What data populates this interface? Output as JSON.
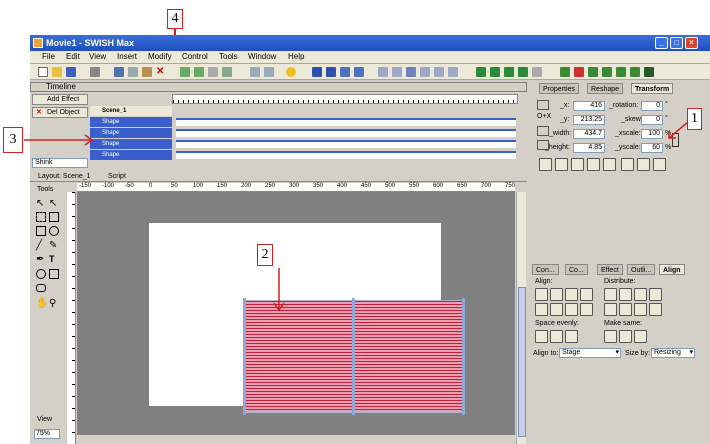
{
  "window": {
    "title": "Movie1 - SWISH Max"
  },
  "menu": [
    "File",
    "Edit",
    "View",
    "Insert",
    "Modify",
    "Control",
    "Tools",
    "Window",
    "Help"
  ],
  "timeline": {
    "header": "Timeline",
    "add_effect": "Add Effect",
    "del_object": "Del Object",
    "scene_label": "Scene_1",
    "rows": [
      "Shape",
      "Shape",
      "Shape",
      "Shape"
    ],
    "effect_field": "Shink"
  },
  "layout": {
    "tab_layout": "Layout: Scene_1",
    "tab_script": "Script",
    "tools_label": "Tools",
    "view_label": "View",
    "zoom": "75%",
    "ruler_ticks": [
      "-150",
      "-100",
      "-50",
      "0",
      "50",
      "100",
      "150",
      "200",
      "250",
      "300",
      "350",
      "400",
      "450",
      "500",
      "550",
      "600",
      "650",
      "700",
      "750"
    ]
  },
  "right_panel": {
    "tabs": [
      "Properties",
      "Reshape",
      "Transform"
    ],
    "transform": {
      "x_label": "_x:",
      "x": "416",
      "y_label": "_y:",
      "y": "213.25",
      "width_label": "_width:",
      "width": "434.7",
      "height_label": "_height:",
      "height": "4.85",
      "rotation_label": "_rotation:",
      "rotation": "0",
      "skew_label": "_skew:",
      "skew": "0",
      "xscale_label": "_xscale:",
      "xscale": "100",
      "yscale_label": "_yscale:",
      "yscale": "60",
      "ox_label": "O+X",
      "pct1": "%",
      "pct2": "%",
      "deg1": "°",
      "deg2": "°"
    },
    "align_tabs": [
      "Con...",
      "Co...",
      "Effect",
      "Outli...",
      "Align"
    ],
    "align": {
      "align_label": "Align:",
      "distribute_label": "Distribute:",
      "space_label": "Space evenly:",
      "same_label": "Make same:",
      "align_to_label": "Align to:",
      "align_to_value": "Stage",
      "size_by_label": "Size by:",
      "size_by_value": "Resizing"
    }
  },
  "callouts": [
    "1",
    "2",
    "3",
    "4"
  ]
}
